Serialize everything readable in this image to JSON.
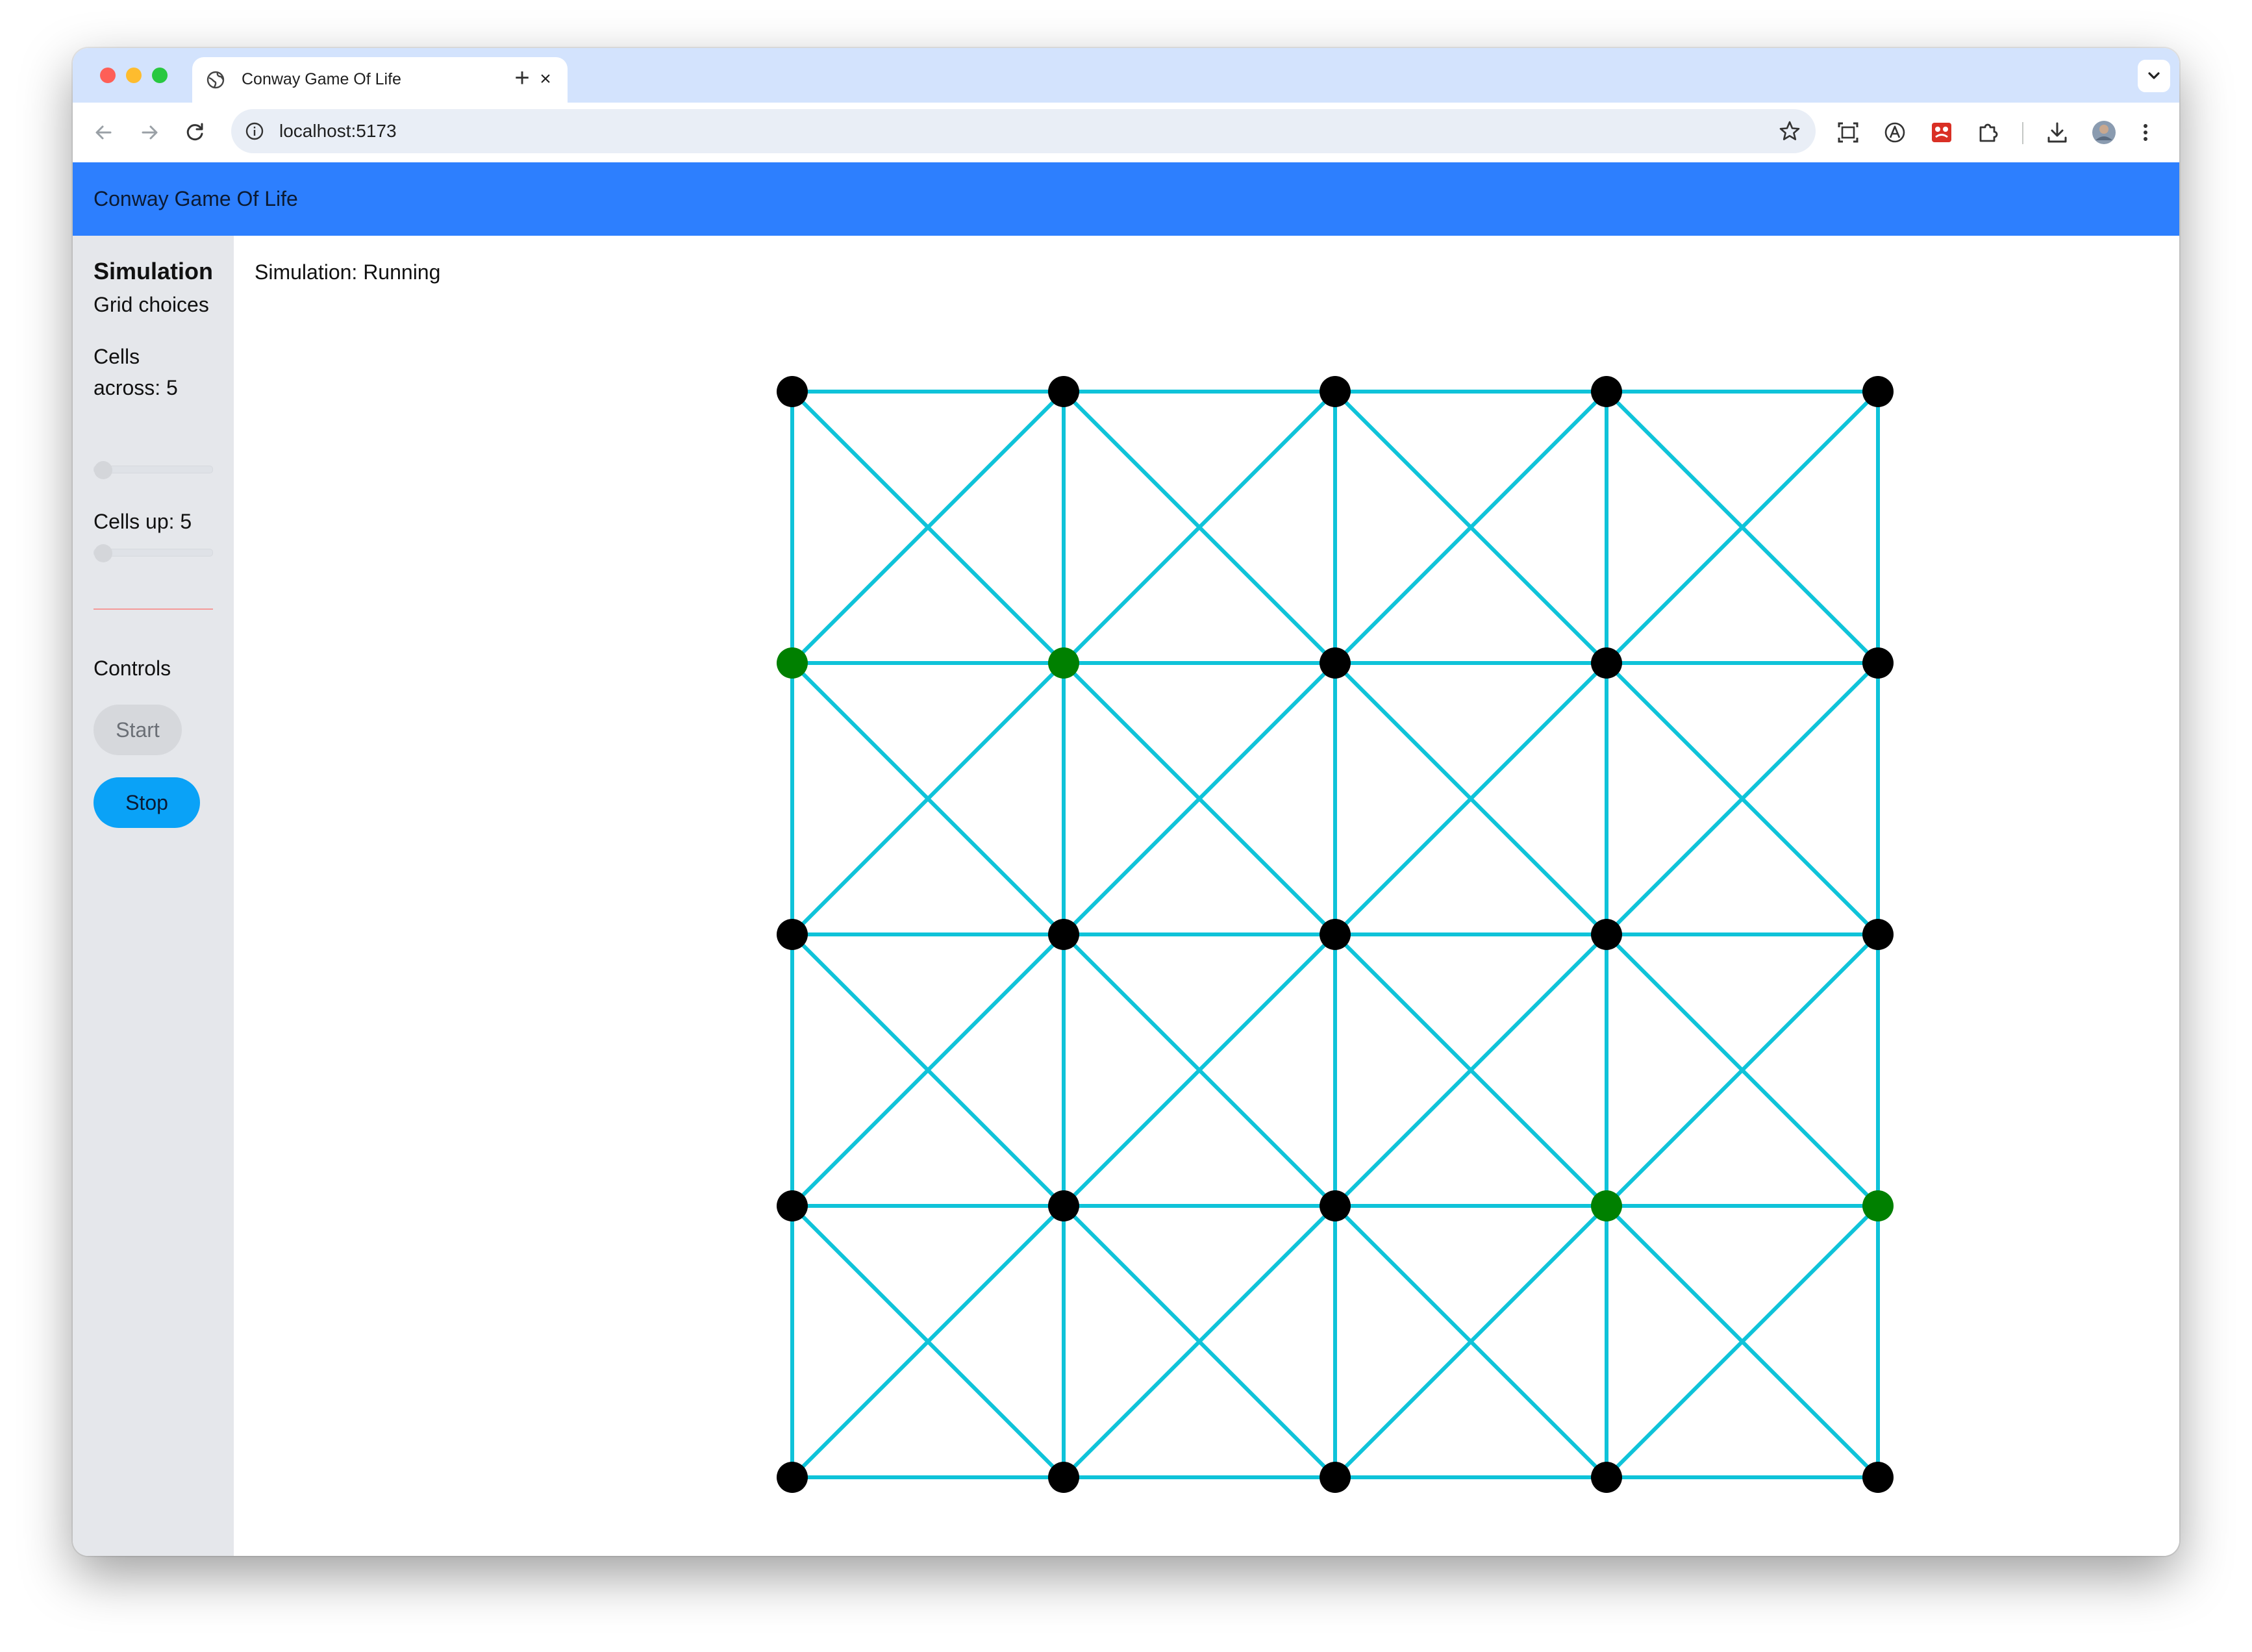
{
  "browser": {
    "tab_title": "Conway Game Of Life",
    "tab_close": "×",
    "new_tab": "+",
    "url": "localhost:5173"
  },
  "app": {
    "title": "Conway Game Of Life"
  },
  "sidebar": {
    "heading": "Simulation",
    "subheading": "Grid choices",
    "cells_across_label": "Cells",
    "cells_across_value_label": "across: 5",
    "cells_across": 5,
    "cells_up_label": "Cells up: 5",
    "cells_up": 5,
    "controls_label": "Controls",
    "start_label": "Start",
    "stop_label": "Stop"
  },
  "main": {
    "status": "Simulation: Running"
  },
  "grid": {
    "cols": 5,
    "rows": 5,
    "alive_color": "#008000",
    "dead_color": "#000000",
    "edge_color": "#0fc3d9",
    "cells": [
      [
        0,
        0,
        0,
        0,
        0
      ],
      [
        1,
        1,
        0,
        0,
        0
      ],
      [
        0,
        0,
        0,
        0,
        0
      ],
      [
        0,
        0,
        0,
        1,
        1
      ],
      [
        0,
        0,
        0,
        0,
        0
      ]
    ]
  }
}
